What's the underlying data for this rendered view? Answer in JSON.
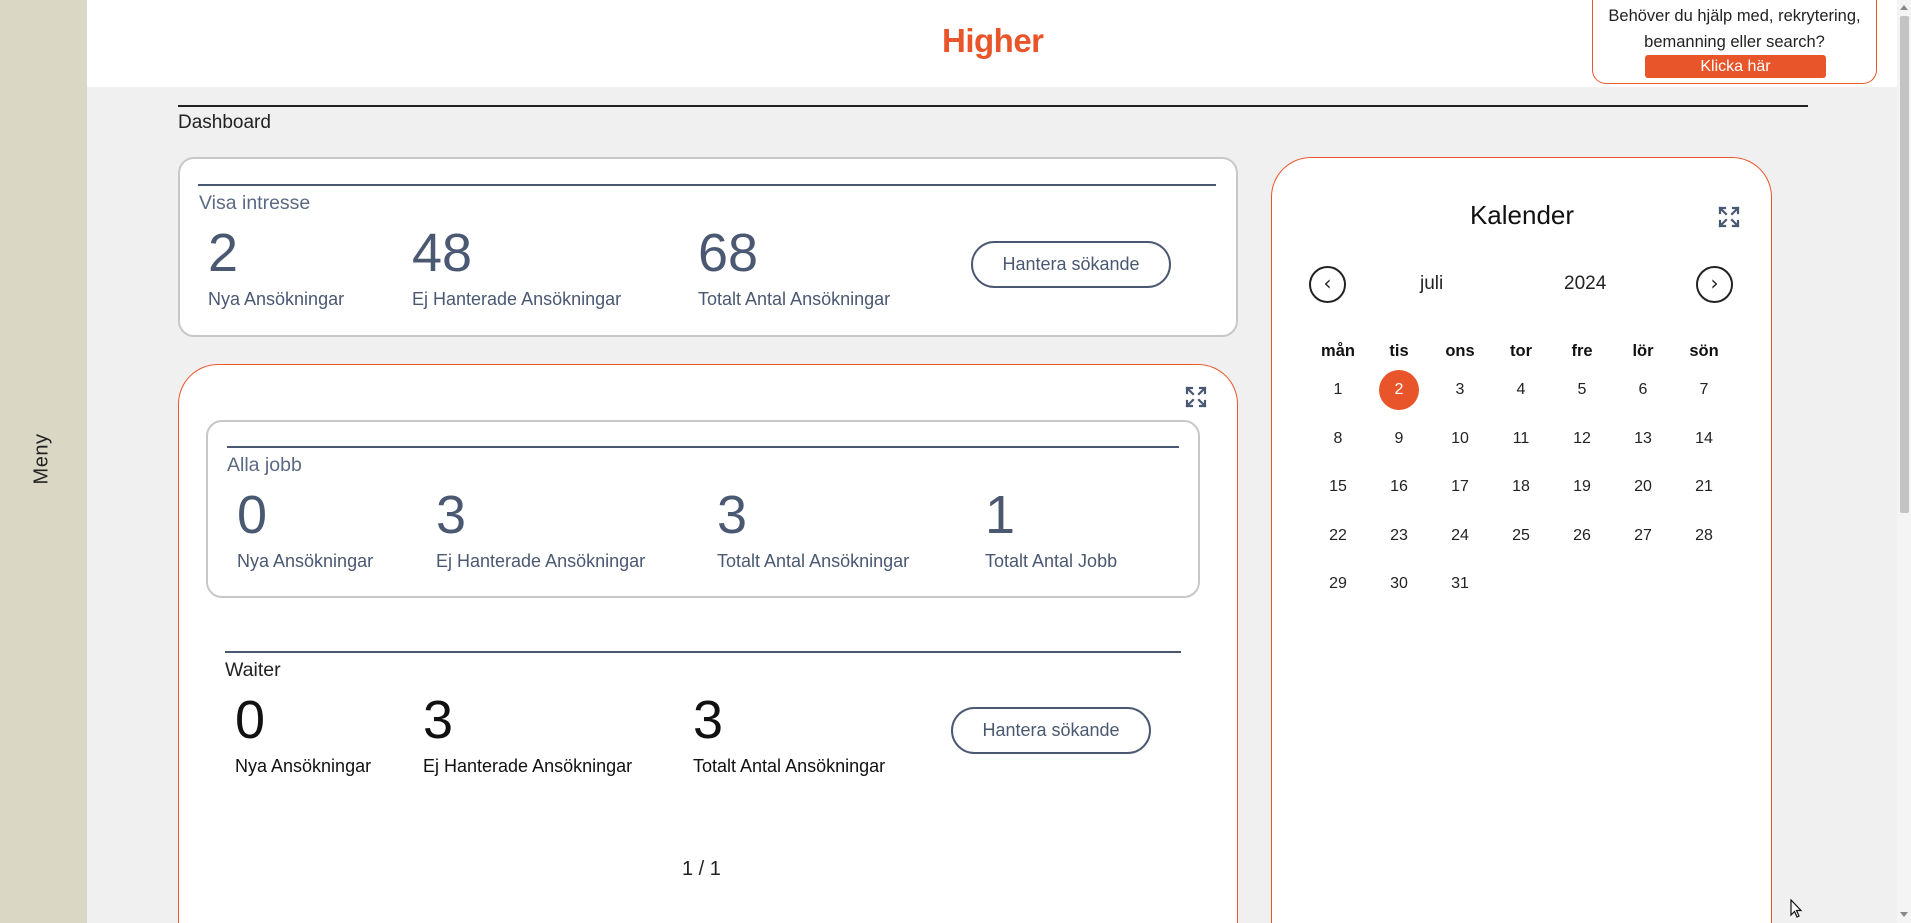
{
  "sidebar": {
    "menu_label": "Meny"
  },
  "header": {
    "logo": "Higher",
    "help_text": "Behöver du hjälp med, rekrytering, bemanning eller search?",
    "help_button": "Klicka här"
  },
  "page_title": "Dashboard",
  "visa_intresse": {
    "title": "Visa intresse",
    "stats": [
      {
        "value": "2",
        "label": "Nya Ansökningar"
      },
      {
        "value": "48",
        "label": "Ej Hanterade Ansökningar"
      },
      {
        "value": "68",
        "label": "Totalt Antal Ansökningar"
      }
    ],
    "button": "Hantera sökande"
  },
  "alla_jobb": {
    "title": "Alla jobb",
    "stats": [
      {
        "value": "0",
        "label": "Nya Ansökningar"
      },
      {
        "value": "3",
        "label": "Ej Hanterade Ansökningar"
      },
      {
        "value": "3",
        "label": "Totalt Antal Ansökningar"
      },
      {
        "value": "1",
        "label": "Totalt Antal Jobb"
      }
    ]
  },
  "waiter": {
    "title": "Waiter",
    "stats": [
      {
        "value": "0",
        "label": "Nya Ansökningar"
      },
      {
        "value": "3",
        "label": "Ej Hanterade Ansökningar"
      },
      {
        "value": "3",
        "label": "Totalt Antal Ansökningar"
      }
    ],
    "button": "Hantera sökande"
  },
  "pagination": "1 / 1",
  "calendar": {
    "title": "Kalender",
    "month": "juli",
    "year": "2024",
    "prev": "‹",
    "next": "›",
    "weekdays": [
      "mån",
      "tis",
      "ons",
      "tor",
      "fre",
      "lör",
      "sön"
    ],
    "weeks": [
      [
        "1",
        "2",
        "3",
        "4",
        "5",
        "6",
        "7"
      ],
      [
        "8",
        "9",
        "10",
        "11",
        "12",
        "13",
        "14"
      ],
      [
        "15",
        "16",
        "17",
        "18",
        "19",
        "20",
        "21"
      ],
      [
        "22",
        "23",
        "24",
        "25",
        "26",
        "27",
        "28"
      ],
      [
        "29",
        "30",
        "31",
        "",
        "",
        "",
        ""
      ]
    ],
    "today": "2"
  },
  "colors": {
    "accent": "#e8552a",
    "primary": "#4a5872",
    "sidebar": "#dad8c4"
  },
  "icons": {
    "expand": "expand-icon",
    "prev": "chevron-left-icon",
    "next": "chevron-right-icon"
  }
}
